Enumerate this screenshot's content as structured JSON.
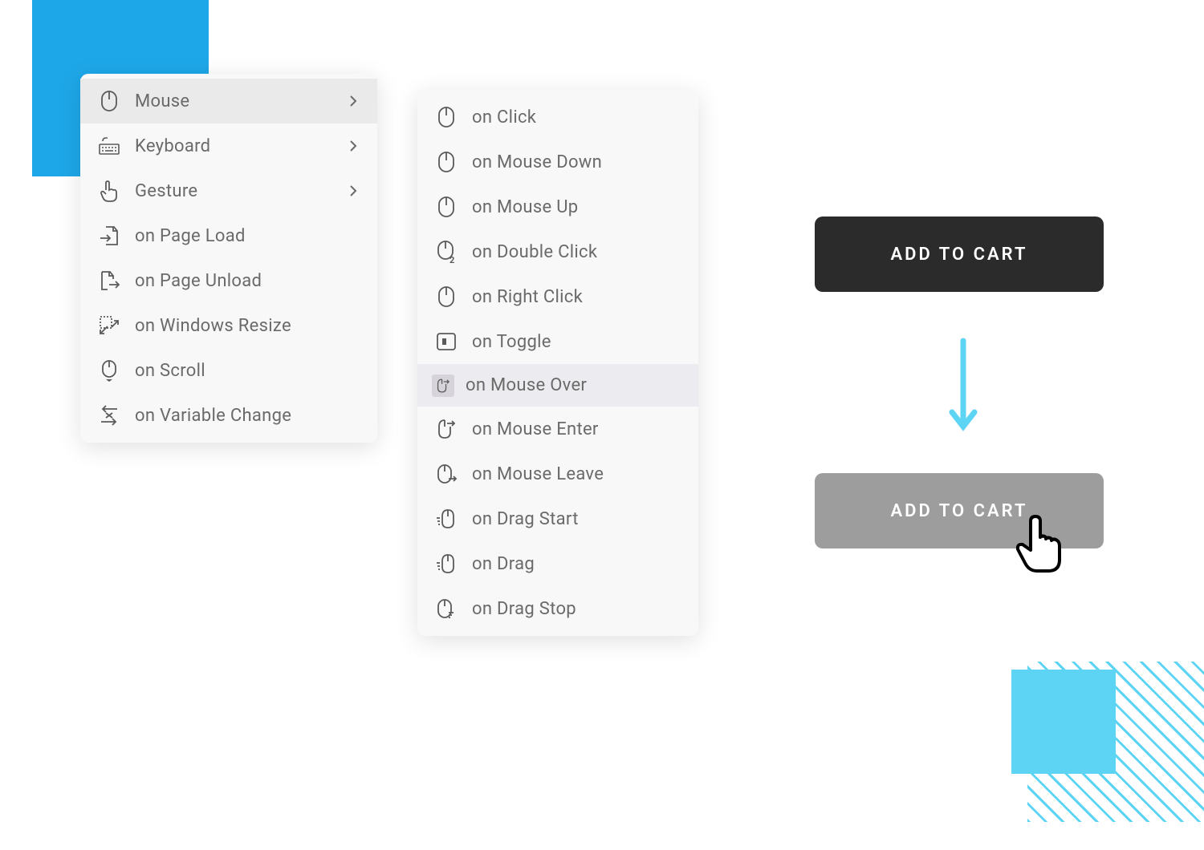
{
  "primaryMenu": {
    "items": [
      {
        "label": "Mouse",
        "icon": "mouse",
        "hasSubmenu": true,
        "selected": true
      },
      {
        "label": "Keyboard",
        "icon": "keyboard",
        "hasSubmenu": true,
        "selected": false
      },
      {
        "label": "Gesture",
        "icon": "gesture",
        "hasSubmenu": true,
        "selected": false
      },
      {
        "label": "on Page Load",
        "icon": "page-load",
        "hasSubmenu": false,
        "selected": false
      },
      {
        "label": "on Page Unload",
        "icon": "page-unload",
        "hasSubmenu": false,
        "selected": false
      },
      {
        "label": "on Windows Resize",
        "icon": "window-resize",
        "hasSubmenu": false,
        "selected": false
      },
      {
        "label": "on Scroll",
        "icon": "scroll",
        "hasSubmenu": false,
        "selected": false
      },
      {
        "label": "on Variable Change",
        "icon": "variable-change",
        "hasSubmenu": false,
        "selected": false
      }
    ]
  },
  "secondaryMenu": {
    "items": [
      {
        "label": "on Click",
        "icon": "mouse"
      },
      {
        "label": "on Mouse Down",
        "icon": "mouse"
      },
      {
        "label": "on Mouse Up",
        "icon": "mouse"
      },
      {
        "label": "on Double Click",
        "icon": "mouse-double"
      },
      {
        "label": "on Right Click",
        "icon": "mouse"
      },
      {
        "label": "on Toggle",
        "icon": "toggle"
      },
      {
        "label": "on Mouse Over",
        "icon": "mouse-over",
        "hovered": true
      },
      {
        "label": "on Mouse Enter",
        "icon": "mouse-enter"
      },
      {
        "label": "on Mouse Leave",
        "icon": "mouse-leave"
      },
      {
        "label": "on Drag Start",
        "icon": "drag-start"
      },
      {
        "label": "on Drag",
        "icon": "drag"
      },
      {
        "label": "on Drag Stop",
        "icon": "drag-stop"
      }
    ]
  },
  "buttons": {
    "addToCart": "ADD TO CART"
  }
}
